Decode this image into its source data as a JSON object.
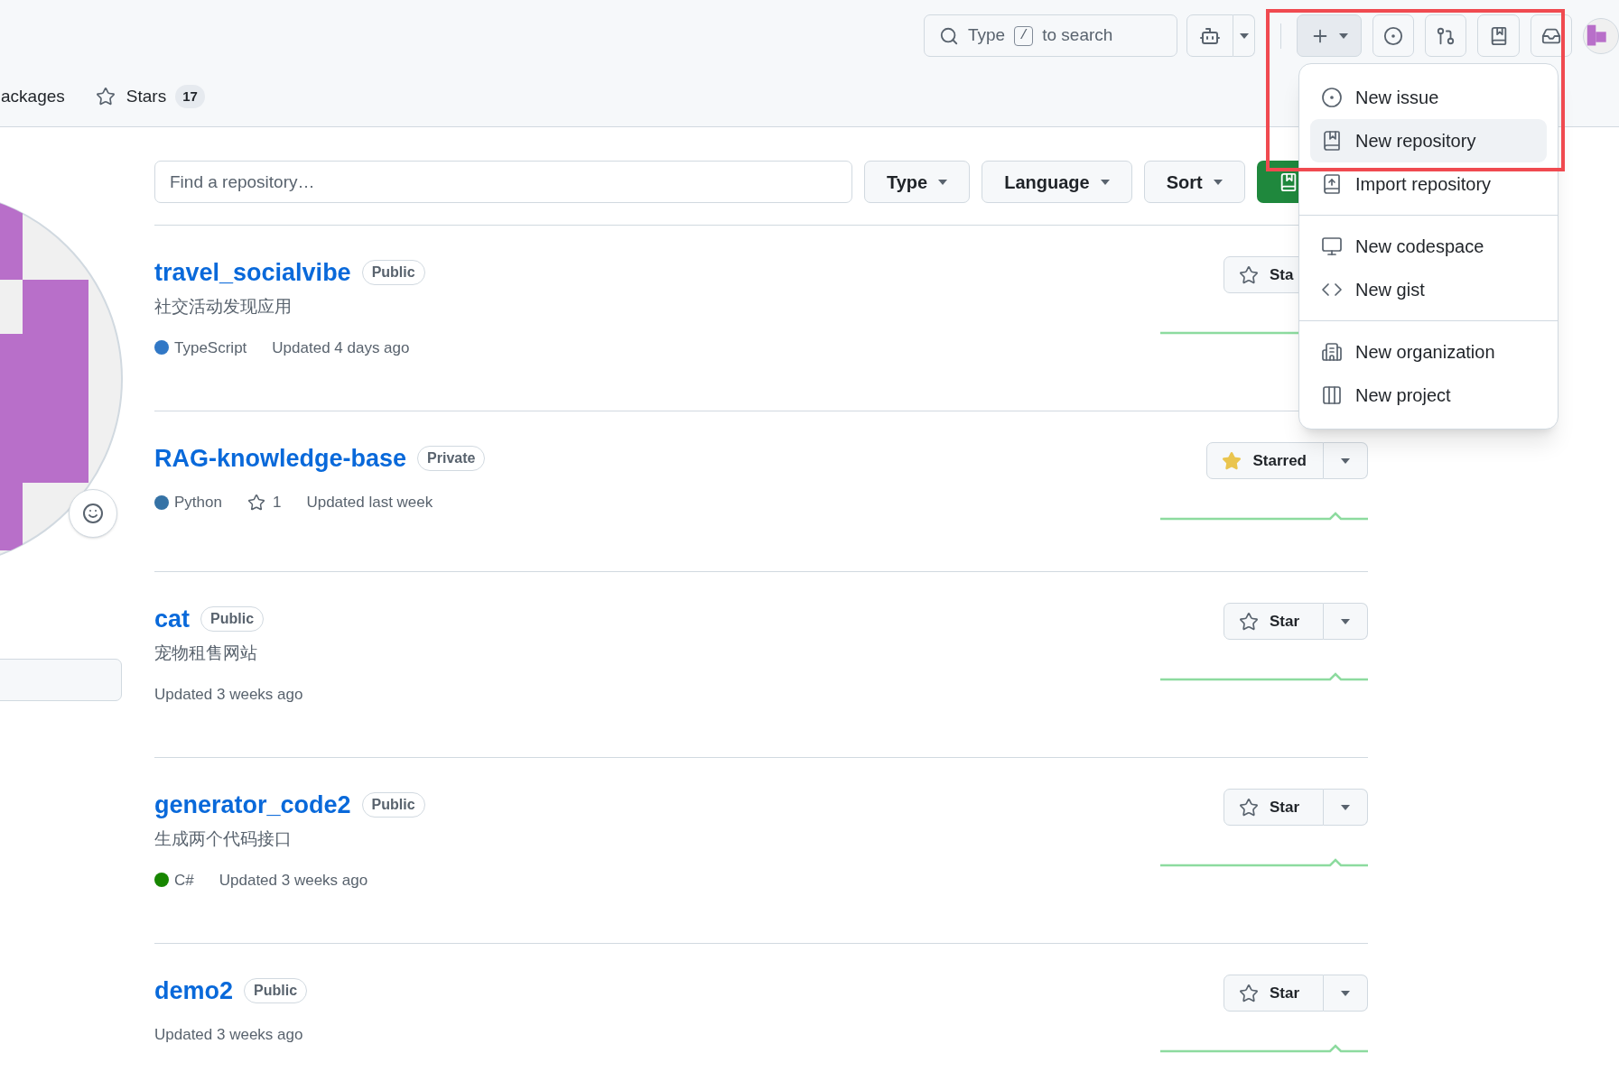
{
  "header": {
    "search": {
      "text_before": "Type",
      "key": "/",
      "text_after": "to search"
    },
    "tabs": [
      {
        "label": "ackages"
      },
      {
        "label": "Stars",
        "count": "17"
      }
    ]
  },
  "create_menu": {
    "groups": [
      [
        {
          "label": "New issue",
          "selected": false
        },
        {
          "label": "New repository",
          "selected": true
        },
        {
          "label": "Import repository",
          "selected": false
        }
      ],
      [
        {
          "label": "New codespace",
          "selected": false
        },
        {
          "label": "New gist",
          "selected": false
        }
      ],
      [
        {
          "label": "New organization",
          "selected": false
        },
        {
          "label": "New project",
          "selected": false
        }
      ]
    ]
  },
  "filters": {
    "search": {
      "placeholder": "Find a repository…"
    },
    "buttons": [
      "Type",
      "Language",
      "Sort"
    ]
  },
  "repositories": [
    {
      "name": "travel_socialvibe",
      "visibility": "Public",
      "description": "社交活动发现应用",
      "language": "TypeScript",
      "color": "#3178c6",
      "updated": "Updated 4 days ago",
      "star_label": "Sta",
      "starred": false
    },
    {
      "name": "RAG-knowledge-base",
      "visibility": "Private",
      "language": "Python",
      "color": "#3572a5",
      "stars": "1",
      "updated": "Updated last week",
      "star_label": "Starred",
      "starred": true
    },
    {
      "name": "cat",
      "visibility": "Public",
      "description": "宠物租售网站",
      "updated": "Updated 3 weeks ago",
      "star_label": "Star",
      "starred": false
    },
    {
      "name": "generator_code2",
      "visibility": "Public",
      "description": "生成两个代码接口",
      "language": "C#",
      "color": "#178600",
      "updated": "Updated 3 weeks ago",
      "star_label": "Star",
      "starred": false
    },
    {
      "name": "demo2",
      "visibility": "Public",
      "updated": "Updated 3 weeks ago",
      "star_label": "Star",
      "starred": false
    }
  ]
}
